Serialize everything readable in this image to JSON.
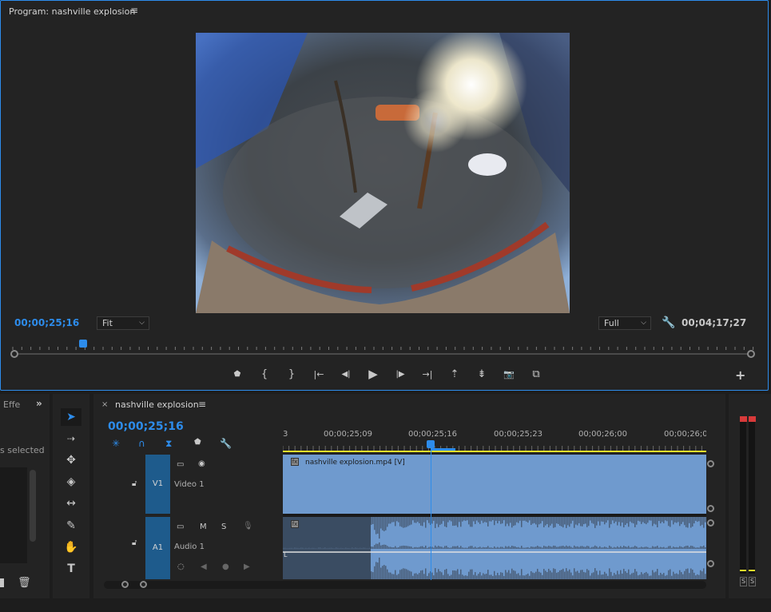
{
  "program_monitor": {
    "title": "Program: nashville explosion",
    "menu": "≡",
    "current_timecode": "00;00;25;16",
    "zoom_option": "Fit",
    "resolution_option": "Full",
    "duration_timecode": "00;04;17;27",
    "transport": {
      "add_marker": "⬟",
      "mark_in": "{",
      "mark_out": "}",
      "go_to_in": "|←",
      "step_back": "◀|",
      "play": "▶",
      "step_forward": "|▶",
      "go_to_out": "→|",
      "lift": "⇡",
      "extract": "⇟",
      "export_frame": "📷",
      "comparison": "⧉",
      "add": "+"
    }
  },
  "effects_panel": {
    "tab_label": "Effe",
    "selected_text": "s selected"
  },
  "timeline": {
    "close": "×",
    "title": "nashville explosion",
    "menu": "≡",
    "timecode": "00;00;25;16",
    "ruler_labels": [
      "3",
      "00;00;25;09",
      "00;00;25;16",
      "00;00;25;23",
      "00;00;26;00",
      "00;00;26;0"
    ],
    "tracks": {
      "v1": {
        "target": "V1",
        "name": "Video 1"
      },
      "a1": {
        "target": "A1",
        "name": "Audio 1",
        "mute": "M",
        "solo": "S"
      }
    },
    "video_clip": "nashville explosion.mp4 [V]",
    "fx_badge": "fx"
  },
  "audio_meter": {
    "solo_left": "S",
    "solo_right": "S"
  },
  "colors": {
    "accent": "#2d8ceb",
    "clip": "#6f9ace",
    "target": "#1e5b8c",
    "peak": "#d83a3a",
    "work_area": "#e8e02a"
  }
}
